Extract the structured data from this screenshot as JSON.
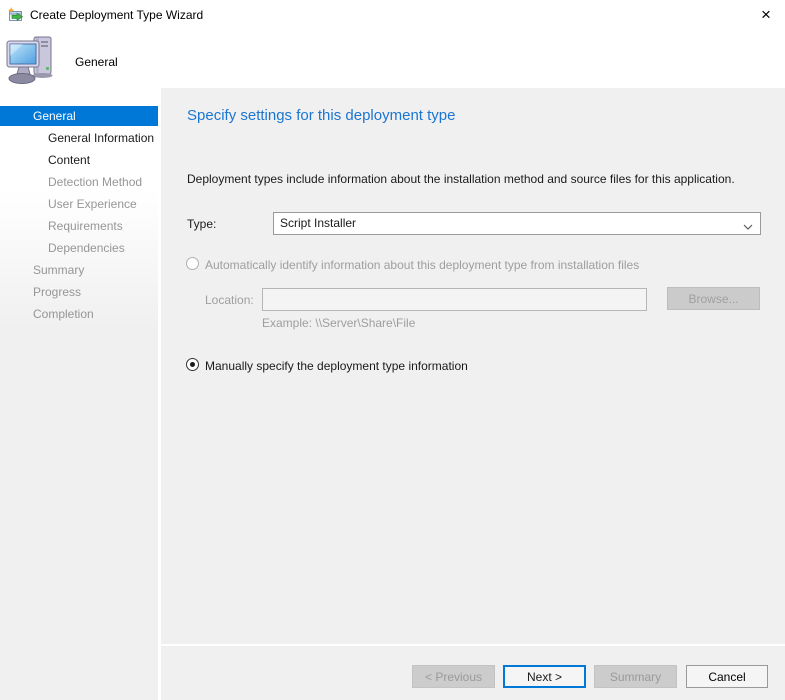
{
  "window": {
    "title": "Create Deployment Type Wizard"
  },
  "icons": {
    "close": "×"
  },
  "header": {
    "title": "General"
  },
  "sidebar": {
    "items": [
      {
        "label": "General",
        "state": "selected",
        "indent": 0
      },
      {
        "label": "General Information",
        "state": "enabled",
        "indent": 1
      },
      {
        "label": "Content",
        "state": "enabled",
        "indent": 1
      },
      {
        "label": "Detection Method",
        "state": "disabled",
        "indent": 1
      },
      {
        "label": "User Experience",
        "state": "disabled",
        "indent": 1
      },
      {
        "label": "Requirements",
        "state": "disabled",
        "indent": 1
      },
      {
        "label": "Dependencies",
        "state": "disabled",
        "indent": 1
      },
      {
        "label": "Summary",
        "state": "disabled",
        "indent": 0
      },
      {
        "label": "Progress",
        "state": "disabled",
        "indent": 0
      },
      {
        "label": "Completion",
        "state": "disabled",
        "indent": 0
      }
    ]
  },
  "main": {
    "heading": "Specify settings for this deployment type",
    "description": "Deployment types include information about the installation method and source files for this application.",
    "type_label": "Type:",
    "type_value": "Script Installer",
    "auto_radio_label": "Automatically identify information about this deployment type from installation files",
    "auto_radio_checked": false,
    "location_label": "Location:",
    "location_value": "",
    "browse_label": "Browse...",
    "example_text": "Example: \\\\Server\\Share\\File",
    "manual_radio_label": "Manually specify the deployment type information",
    "manual_radio_checked": true
  },
  "footer": {
    "previous_label": "< Previous",
    "next_label": "Next >",
    "summary_label": "Summary",
    "cancel_label": "Cancel"
  },
  "colors": {
    "accent_blue": "#0078d7",
    "heading_blue": "#1b76d1",
    "panel_gray": "#f0f0f0",
    "disabled_text": "#9e9e9e",
    "disabled_button": "#cccccc"
  }
}
